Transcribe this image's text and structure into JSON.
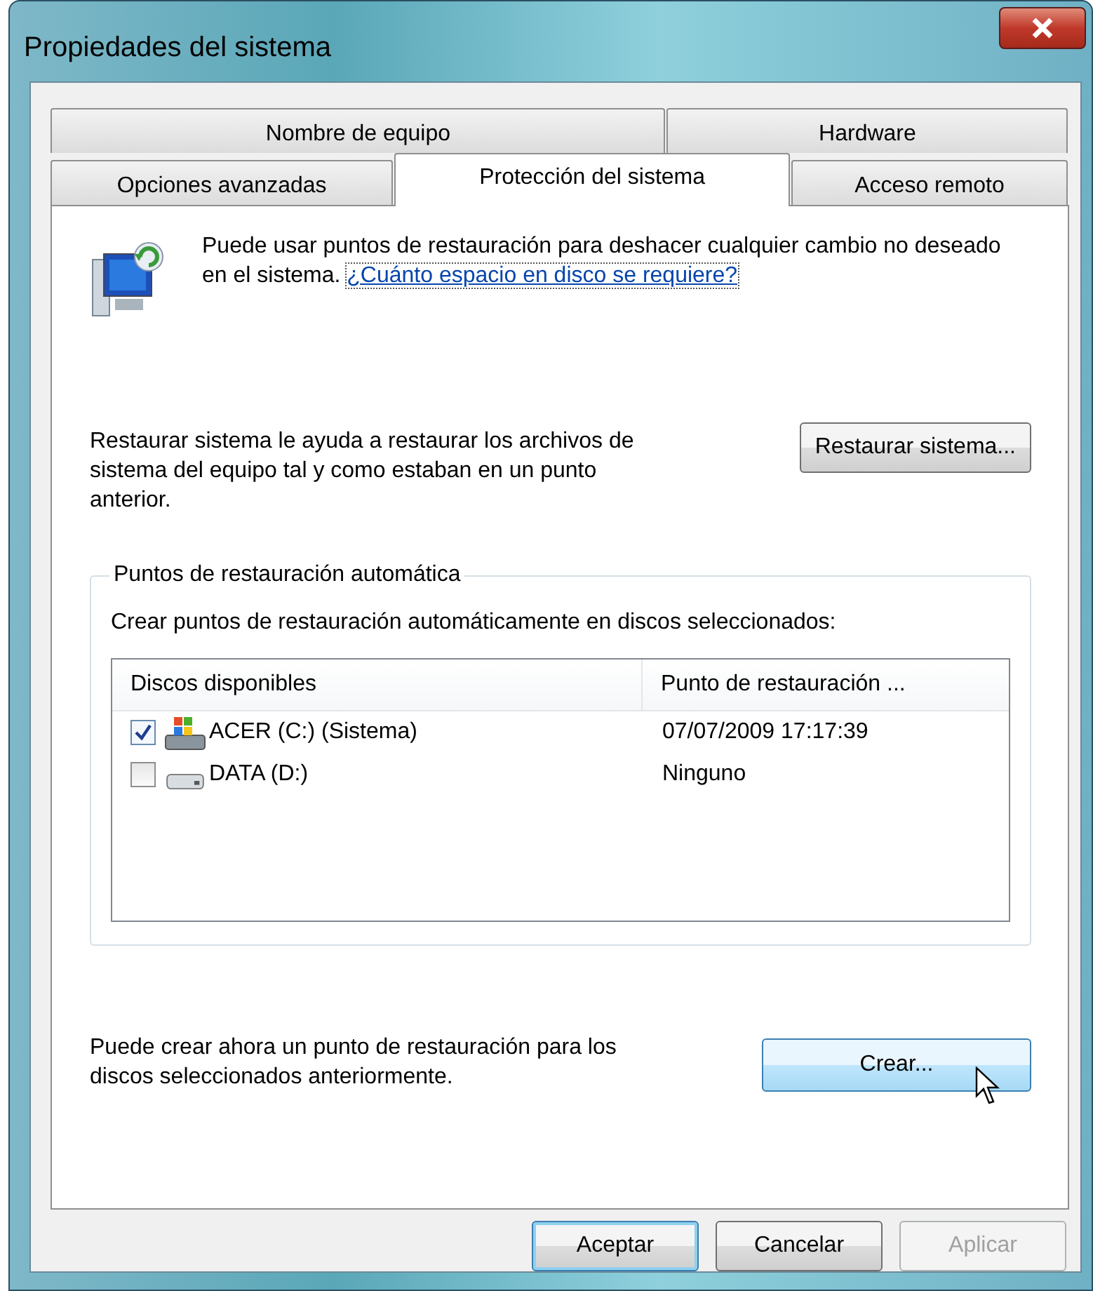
{
  "window": {
    "title": "Propiedades del sistema"
  },
  "tab_rows": [
    [
      {
        "label": "Nombre de equipo",
        "selected": false
      },
      {
        "label": "Hardware",
        "selected": false
      }
    ],
    [
      {
        "label": "Opciones avanzadas",
        "selected": false
      },
      {
        "label": "Protección del sistema",
        "selected": true
      },
      {
        "label": "Acceso remoto",
        "selected": false
      }
    ]
  ],
  "intro": {
    "text": "Puede usar puntos de restauración para deshacer cualquier cambio no deseado en el sistema.",
    "link": "¿Cuánto espacio en disco se requiere?"
  },
  "restore": {
    "text": "Restaurar sistema le ayuda a restaurar los archivos de sistema del equipo tal y como estaban en un punto anterior.",
    "button": "Restaurar sistema..."
  },
  "auto_group": {
    "title": "Puntos de restauración automática",
    "description": "Crear puntos de restauración automáticamente en discos seleccionados:",
    "columns": [
      "Discos disponibles",
      "Punto de restauración ..."
    ],
    "rows": [
      {
        "kind": "system",
        "checked": true,
        "disk": "ACER (C:) (Sistema)",
        "restore_point": "07/07/2009 17:17:39"
      },
      {
        "kind": "data",
        "checked": false,
        "disk": "DATA (D:)",
        "restore_point": "Ninguno"
      }
    ]
  },
  "create": {
    "text": "Puede crear ahora un punto de restauración para los discos seleccionados anteriormente.",
    "button": "Crear...",
    "hovered": true
  },
  "buttons": [
    {
      "label": "Aceptar",
      "default": true,
      "disabled": false
    },
    {
      "label": "Cancelar",
      "default": false,
      "disabled": false
    },
    {
      "label": "Aplicar",
      "default": false,
      "disabled": true
    }
  ]
}
